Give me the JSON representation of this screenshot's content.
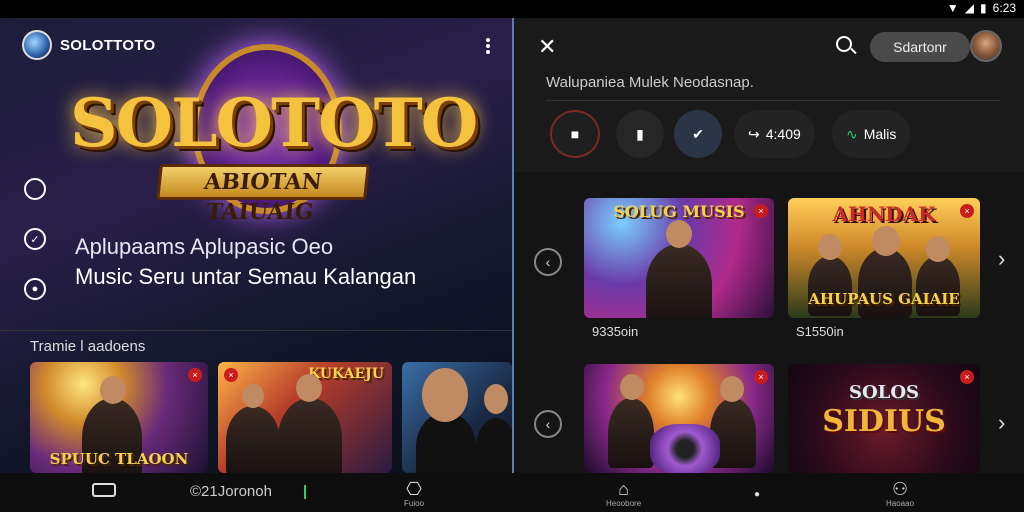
{
  "status": {
    "icons": [
      "wifi-icon",
      "signal-icon",
      "battery-icon"
    ],
    "time": "6:23"
  },
  "left": {
    "brand": "SOLOTTOTO",
    "hero_title": "SOLOTOTO",
    "hero_subtitle": "ABIOTAN TAIUAIG",
    "tagline_line1": "Aplupaams Aplupasic Oeo",
    "tagline_line2": "Music Seru  untar Semau Kalangan",
    "trending_label": "Tramie l aadoens",
    "cards": [
      {
        "title": "SPUUC TLAOON"
      },
      {
        "title": "KUKAEJU"
      },
      {
        "title": ""
      }
    ]
  },
  "right": {
    "search_pill": "Sdartonr",
    "subtitle": "Walupaniea Mulek  Neodasnap.",
    "chip_text_1": "4:409",
    "chip_text_2": "Malis",
    "cards": [
      {
        "title": "SOLUG MUSIS",
        "caption": "9335oin"
      },
      {
        "title": "AHNDAK",
        "subtitle": "AHUPAUS GAIAIE",
        "caption": "S1550in"
      },
      {
        "title": "",
        "caption": ""
      },
      {
        "title": "SIDIUS",
        "subtitle": "SOLOS",
        "caption": ""
      }
    ]
  },
  "nav": {
    "left_search": "©21Joronoh",
    "items": [
      "Fuioo",
      "Heoobore",
      "Haoaao"
    ]
  }
}
